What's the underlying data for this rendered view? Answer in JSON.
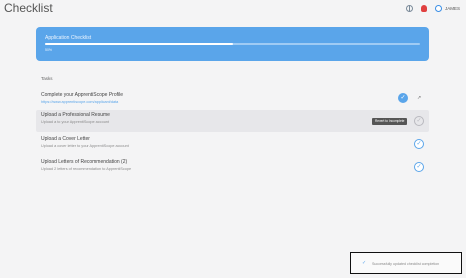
{
  "page": {
    "title": "Checklist"
  },
  "header": {
    "user_name": "JAMES",
    "icons": {
      "globe": "globe-icon",
      "bug": "bug-icon",
      "avatar": "user-avatar-icon"
    }
  },
  "banner": {
    "title": "Application Checklist",
    "progress_fraction": 0.5,
    "progress_text": "50%"
  },
  "tasks": {
    "heading": "Tasks",
    "items": [
      {
        "title": "Complete your ApprentiScope Profile",
        "subtitle": "https://www.apprentiscope.com/applicant/data",
        "status": "done"
      },
      {
        "title": "Upload a Professional Resume",
        "subtitle": "Upload a to your ApprentiScope account",
        "status": "pending",
        "tooltip": "Revert to Incomplete"
      },
      {
        "title": "Upload a Cover Letter",
        "subtitle": "Upload a cover letter to your ApprentiScope account",
        "status": "pending"
      },
      {
        "title": "Upload Letters of Recommendation (2)",
        "subtitle": "Upload 2 letters of recommendation to ApprentiScope",
        "status": "pending"
      }
    ]
  },
  "toast": {
    "message": "Successfully updated checklist completion"
  },
  "colors": {
    "accent": "#5aa5ea",
    "background": "#f4f4f5"
  }
}
